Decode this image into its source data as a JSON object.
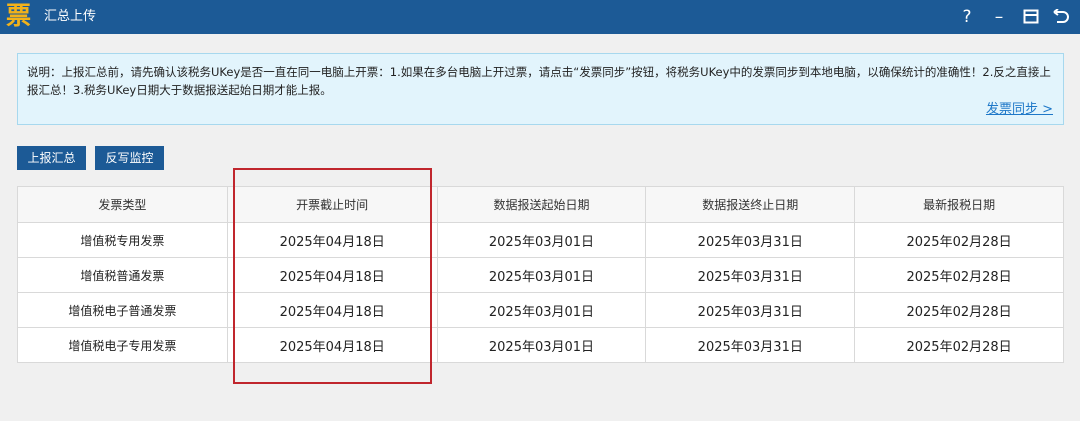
{
  "window": {
    "logo_char": "票",
    "title": "汇总上传",
    "help": "?",
    "minimize": "–",
    "maximize": "□",
    "back": "↶"
  },
  "notice": {
    "text": "说明：上报汇总前，请先确认该税务UKey是否一直在同一电脑上开票：1.如果在多台电脑上开过票，请点击“发票同步”按钮，将税务UKey中的发票同步到本地电脑，以确保统计的准确性！2.反之直接上报汇总！3.税务UKey日期大于数据报送起始日期才能上报。",
    "sync_link": "发票同步 >"
  },
  "toolbar": {
    "report_label": "上报汇总",
    "monitor_label": "反写监控"
  },
  "table": {
    "headers": [
      "发票类型",
      "开票截止时间",
      "数据报送起始日期",
      "数据报送终止日期",
      "最新报税日期"
    ],
    "rows": [
      [
        "增值税专用发票",
        "2025年04月18日",
        "2025年03月01日",
        "2025年03月31日",
        "2025年02月28日"
      ],
      [
        "增值税普通发票",
        "2025年04月18日",
        "2025年03月01日",
        "2025年03月31日",
        "2025年02月28日"
      ],
      [
        "增值税电子普通发票",
        "2025年04月18日",
        "2025年03月01日",
        "2025年03月31日",
        "2025年02月28日"
      ],
      [
        "增值税电子专用发票",
        "2025年04月18日",
        "2025年03月01日",
        "2025年03月31日",
        "2025年02月28日"
      ]
    ]
  },
  "colors": {
    "titlebar": "#1c5a96",
    "highlight": "#c0262d",
    "link": "#1f78c8"
  }
}
